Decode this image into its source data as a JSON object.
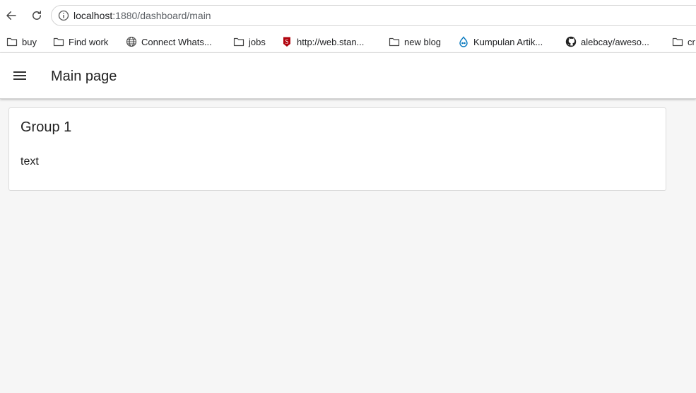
{
  "browser": {
    "url_host": "localhost",
    "url_path": ":1880/dashboard/main"
  },
  "bookmarks": [
    {
      "label": "buy",
      "icon": "folder-icon"
    },
    {
      "label": "Find work",
      "icon": "folder-icon"
    },
    {
      "label": "Connect Whats...",
      "icon": "globe-icon"
    },
    {
      "label": "jobs",
      "icon": "folder-icon"
    },
    {
      "label": "http://web.stan...",
      "icon": "stanford-icon"
    },
    {
      "label": "new blog",
      "icon": "folder-icon"
    },
    {
      "label": "Kumpulan Artik...",
      "icon": "drupal-icon"
    },
    {
      "label": "alebcay/aweso...",
      "icon": "github-icon"
    },
    {
      "label": "cr",
      "icon": "folder-icon"
    }
  ],
  "dashboard": {
    "title": "Main page",
    "group": {
      "title": "Group 1",
      "text": "text"
    }
  },
  "colors": {
    "background": "#f6f6f6",
    "card": "#ffffff",
    "text": "#222222",
    "stanford": "#b1040e",
    "drupal": "#0678be"
  }
}
